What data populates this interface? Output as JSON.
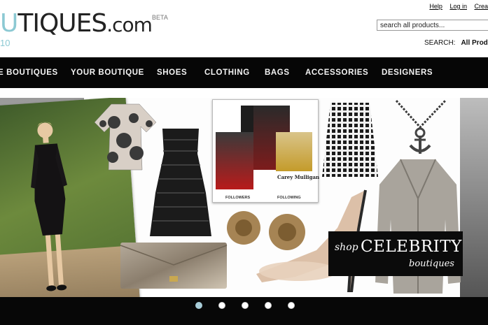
{
  "logo": {
    "word_accent": "U",
    "word_rest": "TIQUES",
    "com": ".com",
    "beta": "BETA",
    "year": "10"
  },
  "toplinks": [
    "Help",
    "Log in",
    "Crea"
  ],
  "search": {
    "placeholder": "search all products...",
    "label": "SEARCH:",
    "scope": "All Produ"
  },
  "nav": [
    "E BOUTIQUES",
    "YOUR BOUTIQUE",
    "SHOES",
    "CLOTHING",
    "BAGS",
    "ACCESSORIES",
    "DESIGNERS"
  ],
  "hero": {
    "collage_caption": "Carey Mulligan",
    "followers": "FOLLOWERS",
    "following": "FOLLOWING",
    "cta_shop": "shop",
    "cta_title": "CELEBRITY",
    "cta_sub": "boutiques"
  },
  "carousel": {
    "count": 5,
    "active_index": 0
  },
  "colors": {
    "accent": "#8cc9d3",
    "nav_bg": "#060606",
    "dot_active": "#a8cdd8"
  }
}
